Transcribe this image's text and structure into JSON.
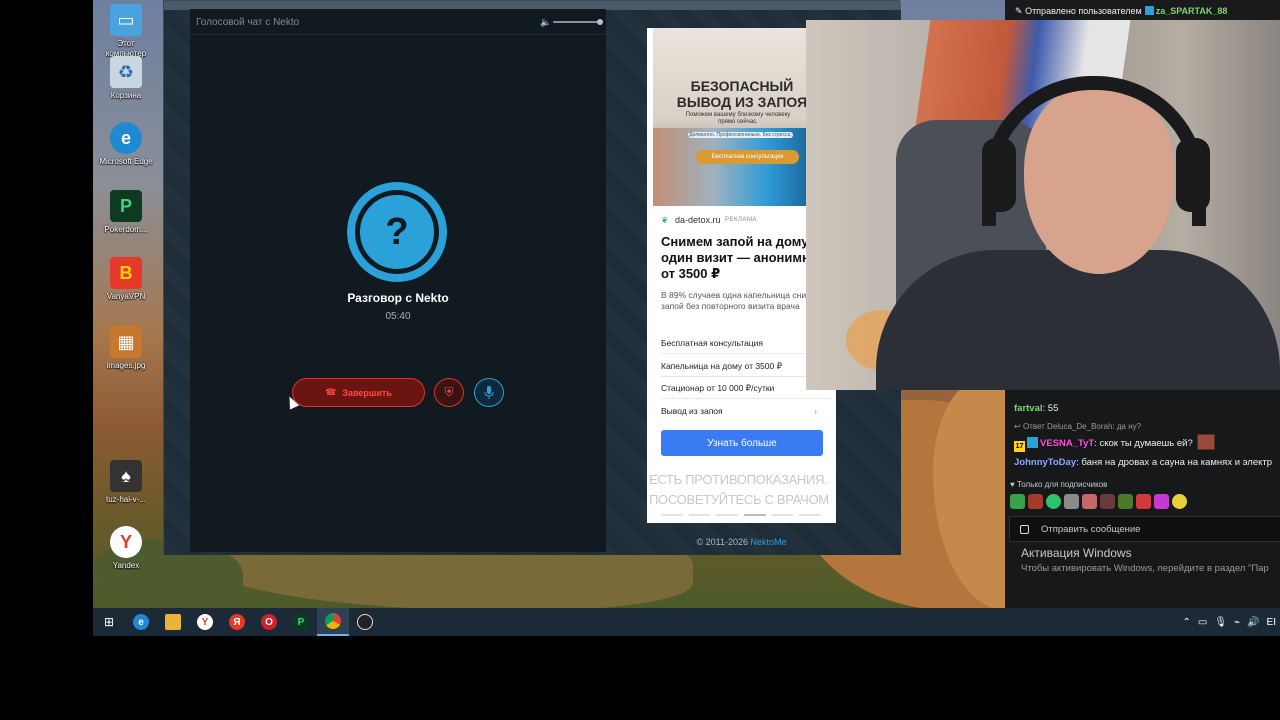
{
  "desktop": {
    "icons": [
      {
        "label": "Этот компьютер",
        "color": "#4aa3df",
        "glyph": "▭"
      },
      {
        "label": "Корзина",
        "color": "#c9d6e0",
        "glyph": "♻"
      },
      {
        "label": "Microsoft Edge",
        "color": "#1f8ad4",
        "glyph": "e"
      },
      {
        "label": "Pokerdom...",
        "color": "#0f3a22",
        "glyph": "P"
      },
      {
        "label": "VanyaVPN",
        "color": "#e53a2a",
        "glyph": "B"
      },
      {
        "label": "images.jpg",
        "color": "#c8782e",
        "glyph": "▦"
      },
      {
        "label": "tuz-hai-v-...",
        "color": "#333333",
        "glyph": "♠"
      },
      {
        "label": "Yandex",
        "color": "#ffffff",
        "glyph": "Y"
      }
    ]
  },
  "nekto": {
    "title": "Голосовой чат с Nekto",
    "talk_title": "Разговор с Nekto",
    "timer": "05:40",
    "end_button": "Завершить",
    "avatar_glyph": "?",
    "copyright_prefix": "© 2011-2026",
    "copyright_link": "NektoMe"
  },
  "ad": {
    "image_title": "БЕЗОПАСНЫЙ ВЫВОД ИЗ ЗАПОЯ",
    "image_subtitle": "Поможем вашему близкому человеку прямо сейчас.",
    "image_note": "Деликатно. Профессионально. Без стресса.",
    "image_button": "Бесплатная консультация",
    "domain": "da-detox.ru",
    "label": "РЕКЛАМА",
    "headline": "Снимем запой на дому за один визит — анонимно, от 3500 ₽",
    "body": "В 89% случаев одна капельница снимает запой без повторного визита врача",
    "links": [
      "Бесплатная консультация",
      "Капельница на дому от 3500 ₽",
      "Стационар от 10 000 ₽/сутки",
      "Вывод из запоя"
    ],
    "cta": "Узнать больше",
    "warning_line1": "ЕСТЬ ПРОТИВОПОКАЗАНИЯ.",
    "warning_line2": "ПОСОВЕТУЙТЕСЬ С ВРАЧОМ"
  },
  "stream": {
    "sent_by_prefix": "Отправлено пользователем",
    "sent_by_user": "za_SPARTAK_88",
    "chat": [
      {
        "user": "fartval",
        "user_color": "#7bd96a",
        "text": "55"
      },
      {
        "reply_note": "Ответ Deluca_De_Borah: да ну?"
      },
      {
        "user": "VESNA_TyT",
        "user_color": "#ff4fd8",
        "text": "скок ты думаешь ей?",
        "badge": "17"
      },
      {
        "user": "JohnnyToDay",
        "user_color": "#8aa8ff",
        "text": "баня на дровах а сауна на камнях и электр"
      }
    ],
    "subs_only": "Только для подписчиков",
    "input_placeholder": "Отправить сообщение",
    "activation_title": "Активация Windows",
    "activation_sub": "Чтобы активировать Windows, перейдите в раздел \"Пар"
  },
  "taskbar": {
    "tray_lang": "EI"
  }
}
